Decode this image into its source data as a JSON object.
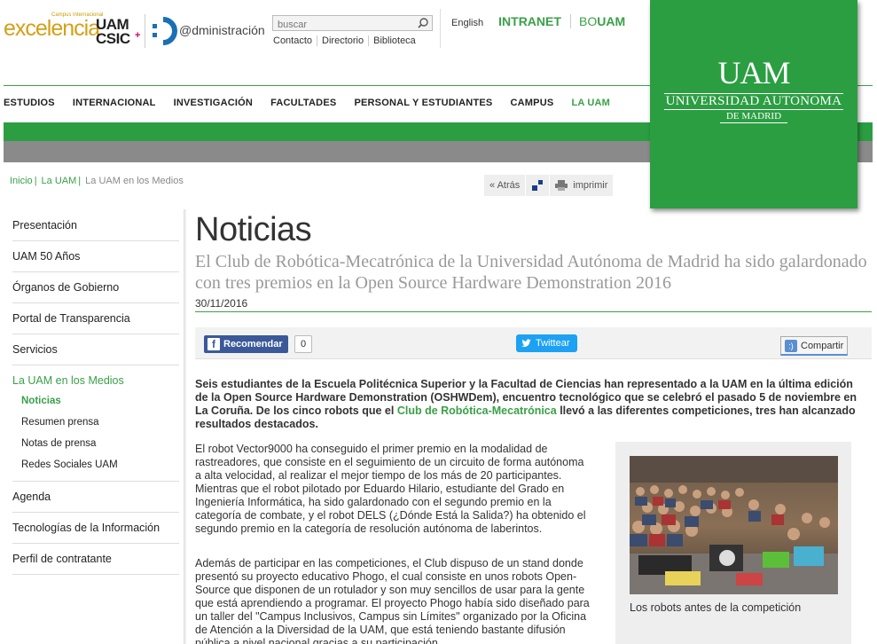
{
  "header": {
    "excelencia_small": "Campus Internacional",
    "excelencia_big": "excelencia",
    "uam_line1": "UAM",
    "uam_line2": "CSIC",
    "uam_plus": "+",
    "admin_text": "@dministración",
    "search_placeholder": "buscar",
    "top_links": [
      "Contacto",
      "Directorio",
      "Biblioteca"
    ],
    "english": "English",
    "intranet": "INTRANET",
    "bouam_prefix": "BO",
    "bouam_suffix": "UAM"
  },
  "brand_box": {
    "line1": "UAM",
    "line2": "UNIVERSIDAD AUTONOMA",
    "line3": "DE MADRID",
    "color": "#2b9e42"
  },
  "nav": {
    "items": [
      "ESTUDIOS",
      "INTERNACIONAL",
      "INVESTIGACIÓN",
      "FACULTADES",
      "PERSONAL Y ESTUDIANTES",
      "CAMPUS",
      "LA UAM"
    ],
    "active": "LA UAM"
  },
  "breadcrumb": {
    "items": [
      "Inicio",
      "La UAM",
      "La UAM en los Medios"
    ]
  },
  "tools": {
    "back": "« Atrás",
    "print": "imprimir"
  },
  "sidebar": {
    "items": [
      "Presentación",
      "UAM 50 Años",
      "Órganos de Gobierno",
      "Portal de Transparencia",
      "Servicios"
    ],
    "active_section": "La UAM en los Medios",
    "subitems": [
      "Noticias",
      "Resumen prensa",
      "Notas de prensa",
      "Redes Sociales UAM"
    ],
    "active_sub": "Noticias",
    "items_after": [
      "Agenda",
      "Tecnologías de la Información",
      "Perfil de contratante"
    ]
  },
  "article": {
    "section_title": "Noticias",
    "headline": "El Club de Robótica-Mecatrónica de la Universidad Autónoma de Madrid ha sido galardonado con tres premios en la Open Source Hardware Demonstration 2016",
    "date": "30/11/2016",
    "share": {
      "facebook": "Recomendar",
      "facebook_count": "0",
      "twitter": "Twittear",
      "share": "Compartir"
    },
    "lead_part1": "Seis estudiantes de la Escuela Politécnica Superior y la Facultad de Ciencias han representado a la UAM en la última edición de la Open Source Hardware Demonstration (OSHWDem), encuentro tecnológico que se celebró el pasado 5 de noviembre en La Coruña. De los cinco robots que el ",
    "lead_link": "Club de Robótica-Mecatrónica",
    "lead_part2": " llevó a las diferentes competiciones, tres han alcanzado resultados destacados.",
    "paragraph1": "El robot Vector9000 ha conseguido el primer premio en la modalidad de rastreadores, que consiste en el seguimiento de un circuito de forma autónoma a alta velocidad, al realizar el mejor tiempo de los más de 20 participantes. Mientras que el robot pilotado por Eduardo Hilario, estudiante del Grado en Ingeniería Informática, ha sido galardonado con el segundo premio en la categoría de combate, y el robot DELS (¿Dónde Está la Salida?) ha obtenido el segundo premio en la categoría de resolución autónoma de laberintos.",
    "paragraph2": "Además de participar en las competiciones, el Club dispuso de un stand donde presentó su proyecto educativo Phogo, el cual consiste en unos robots Open-Source que disponen de un rotulador y son muy sencillos de usar para la gente que está aprendiendo a programar. El proyecto Phogo había sido diseñado para un taller del \"Campus Inclusivos, Campus sin Límites\" organizado por la Oficina de Atención a la Diversidad de la UAM, que está teniendo bastante difusión pública a nivel nacional gracias a su participación",
    "photo_caption": "Los robots antes de la competición"
  }
}
